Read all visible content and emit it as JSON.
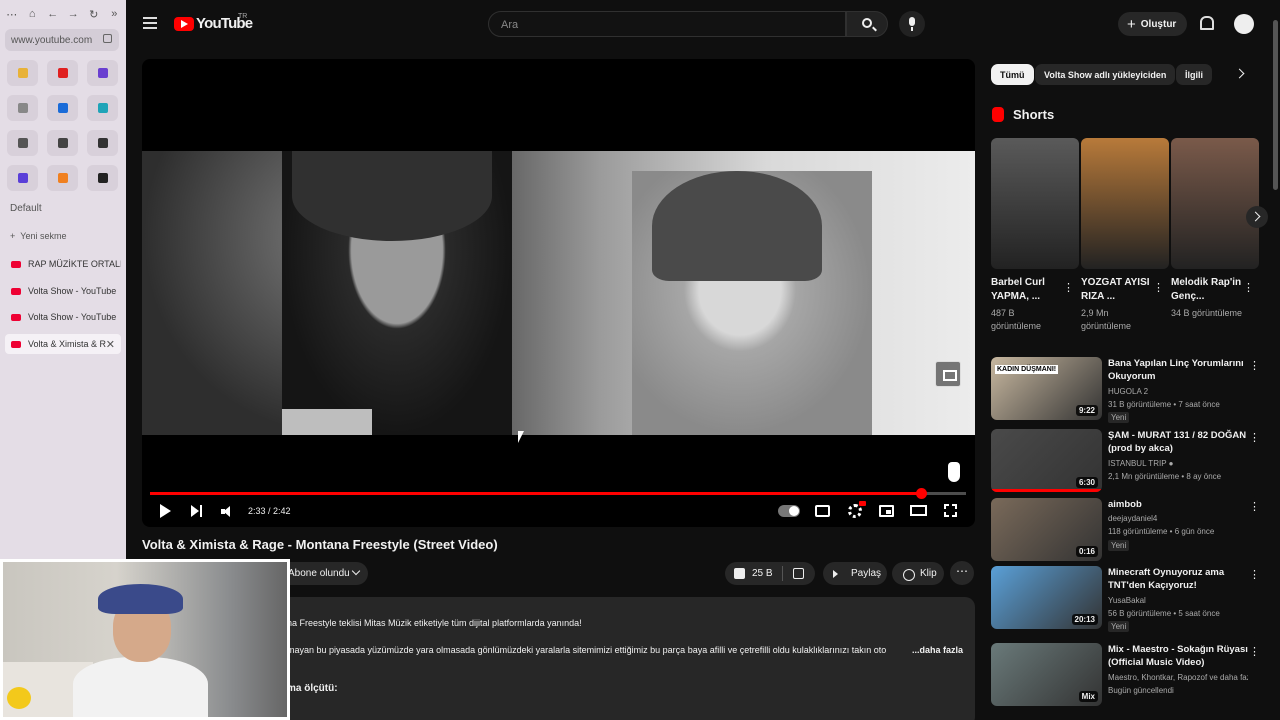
{
  "browser": {
    "url": "www.youtube.com",
    "group_label": "Default",
    "new_tab_label": "Yeni sekme",
    "tabs": [
      {
        "label": "RAP MÜZİKTE ORTALIK K"
      },
      {
        "label": "Volta Show - YouTube"
      },
      {
        "label": "Volta Show - YouTube"
      },
      {
        "label": "Volta & Ximista & R"
      }
    ],
    "tile_colors": [
      "#e8b238",
      "#e02020",
      "#6a3fd0",
      "#888888",
      "#1a6bd8",
      "#1fa4b8",
      "#555555",
      "#444444",
      "#333333",
      "#5a3fd8",
      "#f08020",
      "#222222"
    ]
  },
  "header": {
    "logo_text": "YouTube",
    "region": "TR",
    "search_placeholder": "Ara",
    "create_label": "Oluştur"
  },
  "player": {
    "time": "2:33 / 2:42",
    "progress_fraction": 0.945,
    "title": "Volta & Ximista & Rage - Montana Freestyle (Street Video)",
    "subscribed_label": "Abone olundu",
    "likes": "25 B",
    "share_label": "Paylaş",
    "clip_label": "Klip",
    "more_label": "⋯"
  },
  "description": {
    "line1": "na Freestyle teklisi Mitas Müzik etiketiyle tüm dijital platformlarda yanında!",
    "line2": "mayan bu piyasada yüzümüzde yara olmasada gönlümüzdeki yaralarla sitemimizi ettiğimiz bu parça baya afilli ve çetrefilli oldu kulaklıklarınızı takın oto",
    "more": "...daha fazla",
    "line3": "ma ölçütü:"
  },
  "chips": [
    {
      "label": "Tümü"
    },
    {
      "label": "Volta Show adlı yükleyiciden"
    },
    {
      "label": "İlgili"
    }
  ],
  "shorts": {
    "heading": "Shorts",
    "items": [
      {
        "title": "Barbel Curl YAPMA, ...",
        "views": "487 B görüntüleme",
        "color": "#5a5a5a"
      },
      {
        "title": "YOZGAT AYISI RIZA ...",
        "views": "2,9 Mn görüntüleme",
        "color": "#b87a3a"
      },
      {
        "title": "Melodik Rap'in Genç...",
        "views": "34 B görüntüleme",
        "color": "#7a5a4a"
      }
    ]
  },
  "recommendations": [
    {
      "title": "Bana Yapılan Linç Yorumlarını Okuyorum",
      "channel": "HUGOLA 2",
      "meta": "31 B görüntüleme • 7 saat önce",
      "badge": "Yeni",
      "duration": "9:22",
      "color": "#c8b8a0",
      "thumb_text": "KADIN DÜŞMANI!"
    },
    {
      "title": "ŞAM - MURAT 131 / 82 DOĞAN (prod by akca)",
      "channel": "ISTANBUL TRIP",
      "meta": "2,1 Mn görüntüleme • 8 ay önce",
      "badge": "",
      "duration": "6:30",
      "color": "#4a4a4a",
      "thumb_text": ""
    },
    {
      "title": "aimbob",
      "channel": "deejaydaniel4",
      "meta": "118 görüntüleme • 6 gün önce",
      "badge": "Yeni",
      "duration": "0:16",
      "color": "#7a6a5a",
      "thumb_text": ""
    },
    {
      "title": "Minecraft Oynuyoruz ama TNT'den Kaçıyoruz!",
      "channel": "YusaBakal",
      "meta": "56 B görüntüleme • 5 saat önce",
      "badge": "Yeni",
      "duration": "20:13",
      "color": "#5aa0d8",
      "thumb_text": ""
    },
    {
      "title": "Mix - Maestro - Sokağın Rüyası (Official Music Video)",
      "channel": "Maestro, Khontkar, Rapozof ve daha fazl...",
      "meta": "Bugün güncellendi",
      "badge": "",
      "duration": "Mix",
      "color": "#6a7a7a",
      "thumb_text": ""
    }
  ]
}
